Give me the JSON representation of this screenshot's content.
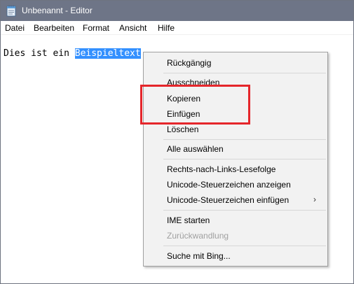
{
  "window": {
    "title": "Unbenannt - Editor"
  },
  "menubar": {
    "items": [
      "Datei",
      "Bearbeiten",
      "Format",
      "Ansicht",
      "Hilfe"
    ]
  },
  "editor": {
    "text_before": "Dies ist ein ",
    "selected_text": "Beispieltext"
  },
  "context_menu": {
    "undo": "Rückgängig",
    "cut": "Ausschneiden",
    "copy": "Kopieren",
    "paste": "Einfügen",
    "delete": "Löschen",
    "select_all": "Alle auswählen",
    "rtl": "Rechts-nach-Links-Lesefolge",
    "show_unicode": "Unicode-Steuerzeichen anzeigen",
    "insert_unicode": "Unicode-Steuerzeichen einfügen",
    "ime_start": "IME starten",
    "reconversion": "Zurückwandlung",
    "search_bing": "Suche mit Bing...",
    "submenu_arrow": "›"
  },
  "colors": {
    "titlebar": "#6e7587",
    "selection": "#3390ff",
    "highlight_box": "#e5262b",
    "menu_bg": "#f2f2f2"
  },
  "icons": {
    "app": "notepad-icon",
    "submenu": "chevron-right-icon"
  }
}
